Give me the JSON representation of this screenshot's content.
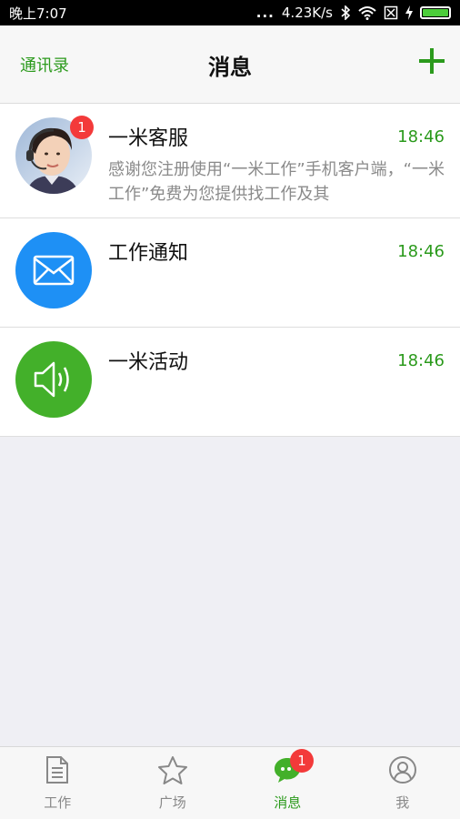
{
  "status_bar": {
    "time": "晚上7:07",
    "dots": "...",
    "speed": "4.23K/s",
    "battery_color": "#4ccd3a"
  },
  "header": {
    "left_link": "通讯录",
    "title": "消息",
    "add_icon": "plus-icon",
    "accent": "#2b9a1c"
  },
  "messages": [
    {
      "name": "一米客服",
      "time": "18:46",
      "preview": "感谢您注册使用“一米工作”手机客户端，“一米工作”免费为您提供找工作及其",
      "badge": "1",
      "avatar": "customer-service-photo"
    },
    {
      "name": "工作通知",
      "time": "18:46",
      "preview": "",
      "avatar": "envelope-icon",
      "avatar_color": "#1e90f5"
    },
    {
      "name": "一米活动",
      "time": "18:46",
      "preview": "",
      "avatar": "speaker-icon",
      "avatar_color": "#43b02a"
    }
  ],
  "tabs": [
    {
      "label": "工作",
      "icon": "document-icon"
    },
    {
      "label": "广场",
      "icon": "star-icon"
    },
    {
      "label": "消息",
      "icon": "chat-icon",
      "badge": "1",
      "active": true
    },
    {
      "label": "我",
      "icon": "user-icon"
    }
  ]
}
